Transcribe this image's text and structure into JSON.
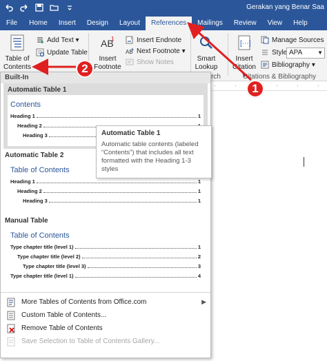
{
  "window": {
    "title": "Gerakan yang Benar Saa",
    "accent": "#2b579a",
    "annotation_color": "#e02020"
  },
  "quick_access": [
    "undo-icon",
    "redo-icon",
    "save-icon",
    "open-icon",
    "customize-icon"
  ],
  "tabs": [
    {
      "label": "File"
    },
    {
      "label": "Home"
    },
    {
      "label": "Insert"
    },
    {
      "label": "Design"
    },
    {
      "label": "Layout"
    },
    {
      "label": "References"
    },
    {
      "label": "Mailings"
    },
    {
      "label": "Review"
    },
    {
      "label": "View"
    },
    {
      "label": "Help"
    }
  ],
  "ribbon": {
    "toc_button": "Table of Contents ▾",
    "add_text": "Add Text ▾",
    "update_table": "Update Table",
    "insert_footnote": "Insert Footnote",
    "insert_endnote": "Insert Endnote",
    "next_footnote": "Next Footnote ▾",
    "show_notes": "Show Notes",
    "smart_lookup": "Smart Lookup",
    "research_group": "rch",
    "insert_citation": "Insert Citation ▾",
    "manage_sources": "Manage Sources",
    "style_label": "Style:",
    "style_value": "APA",
    "bibliography": "Bibliography ▾",
    "citations_group": "Citations & Bibliography"
  },
  "dropdown": {
    "section_builtin": "Built-In",
    "auto1": {
      "title": "Automatic Table 1",
      "heading": "Contents",
      "lines": [
        {
          "text": "Heading 1",
          "page": "1"
        },
        {
          "text": "Heading 2",
          "page": "1"
        },
        {
          "text": "Heading 3",
          "page": "1"
        }
      ]
    },
    "auto2": {
      "title": "Automatic Table 2",
      "heading": "Table of Contents",
      "lines": [
        {
          "text": "Heading 1",
          "page": "1"
        },
        {
          "text": "Heading 2",
          "page": "1"
        },
        {
          "text": "Heading 3",
          "page": "1"
        }
      ]
    },
    "manual": {
      "title": "Manual Table",
      "heading": "Table of Contents",
      "lines": [
        {
          "text": "Type chapter title (level 1)",
          "page": "1"
        },
        {
          "text": "Type chapter title (level 2)",
          "page": "2"
        },
        {
          "text": "Type chapter title (level 3)",
          "page": "3"
        },
        {
          "text": "Type chapter title (level 1)",
          "page": "4"
        }
      ]
    },
    "commands": {
      "more": "More Tables of Contents from Office.com",
      "custom": "Custom Table of Contents...",
      "remove": "Remove Table of Contents",
      "save": "Save Selection to Table of Contents Gallery..."
    }
  },
  "tooltip": {
    "title": "Automatic Table 1",
    "body": "Automatic table contents (labeled “Contents”) that includes all text formatted with the Heading 1-3 styles"
  },
  "annotations": {
    "step1": "1",
    "step2": "2"
  }
}
